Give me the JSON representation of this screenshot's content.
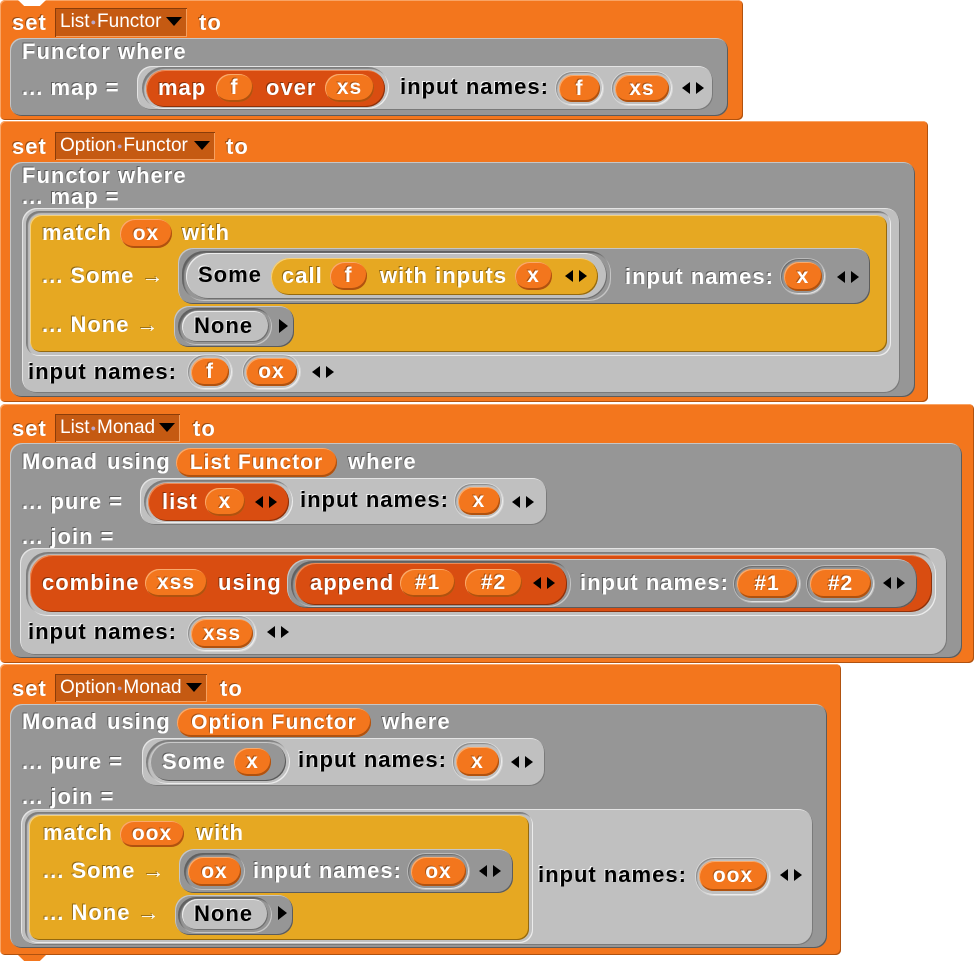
{
  "palette": {
    "variables_orange": "#F3761D",
    "lists_dark_orange": "#D94D11",
    "other_gray": "#969696",
    "zebra_light_gray": "#C0C0C0",
    "control_gold": "#E6A822",
    "dropdown_bg": "#C55A12"
  },
  "scripts": [
    {
      "set_label": "set",
      "variable": "List Functor",
      "to_label": "to",
      "type_name": "Functor",
      "where_label": "where",
      "map_label": "... map =",
      "map_ring": {
        "block": {
          "label": "map",
          "arg": "f",
          "mid_label": "over",
          "arg2": "xs"
        },
        "input_names_label": "input names:",
        "input_names": [
          "f",
          "xs"
        ]
      }
    },
    {
      "set_label": "set",
      "variable": "Option Functor",
      "to_label": "to",
      "type_name": "Functor",
      "where_label": "where",
      "map_label": "... map =",
      "map_ring": {
        "match": {
          "label": "match",
          "subject": "ox",
          "with_label": "with",
          "some_label": "... Some →",
          "some_ring": {
            "block": {
              "label": "Some",
              "call_label": "call",
              "func": "f",
              "with_inputs_label": "with inputs",
              "arg": "x"
            },
            "input_names_label": "input names:",
            "input_names": [
              "x"
            ]
          },
          "none_label": "... None →",
          "none_ring": {
            "block": {
              "label": "None"
            }
          }
        },
        "input_names_label": "input names:",
        "input_names": [
          "f",
          "ox"
        ]
      }
    },
    {
      "set_label": "set",
      "variable": "List Monad",
      "to_label": "to",
      "type_name": "Monad",
      "using_label": "using",
      "functor": "List Functor",
      "where_label": "where",
      "pure_label": "... pure =",
      "pure_ring": {
        "block": {
          "label": "list",
          "arg": "x"
        },
        "input_names_label": "input names:",
        "input_names": [
          "x"
        ]
      },
      "join_label": "... join =",
      "join_ring": {
        "block": {
          "label": "combine",
          "arg": "xss",
          "using_label": "using",
          "ring": {
            "block": {
              "label": "append",
              "args": [
                "#1",
                "#2"
              ]
            },
            "input_names_label": "input names:",
            "input_names": [
              "#1",
              "#2"
            ]
          }
        },
        "input_names_label": "input names:",
        "input_names": [
          "xss"
        ]
      }
    },
    {
      "set_label": "set",
      "variable": "Option Monad",
      "to_label": "to",
      "type_name": "Monad",
      "using_label": "using",
      "functor": "Option Functor",
      "where_label": "where",
      "pure_label": "... pure =",
      "pure_ring": {
        "block": {
          "label": "Some",
          "arg": "x"
        },
        "input_names_label": "input names:",
        "input_names": [
          "x"
        ]
      },
      "join_label": "... join =",
      "join_ring": {
        "match": {
          "label": "match",
          "subject": "oox",
          "with_label": "with",
          "some_label": "... Some →",
          "some_ring": {
            "body_var": "ox",
            "input_names_label": "input names:",
            "input_names": [
              "ox"
            ]
          },
          "none_label": "... None →",
          "none_ring": {
            "block": {
              "label": "None"
            }
          }
        },
        "input_names_label": "input names:",
        "input_names": [
          "oox"
        ]
      }
    }
  ]
}
